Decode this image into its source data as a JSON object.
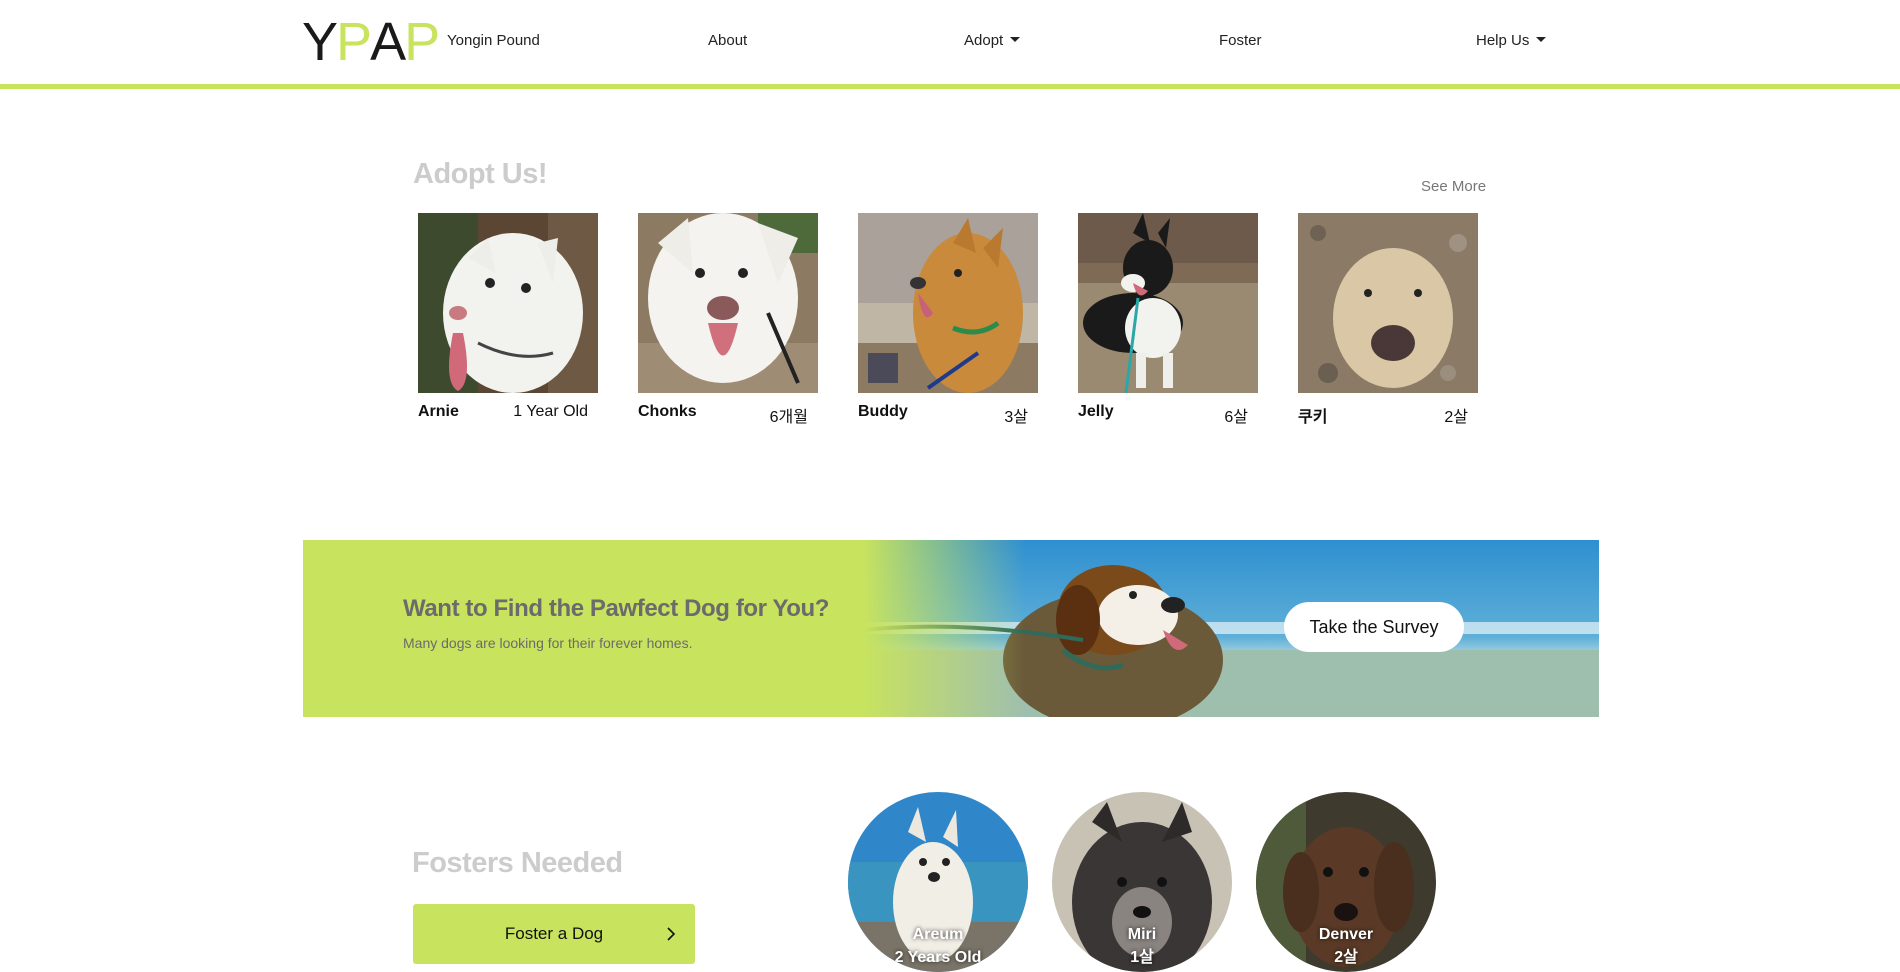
{
  "brand": {
    "logo_letters": [
      "Y",
      "P",
      "A",
      "P"
    ],
    "logo_colors": [
      "#1a1a1a",
      "#c8e35e",
      "#1a1a1a",
      "#c8e35e"
    ],
    "name": "Yongin Pound"
  },
  "nav": {
    "about": "About",
    "adopt": "Adopt",
    "foster": "Foster",
    "help": "Help Us"
  },
  "adopt": {
    "title": "Adopt Us!",
    "see_more": "See More",
    "dogs": [
      {
        "name": "Arnie",
        "age": "1 Year Old"
      },
      {
        "name": "Chonks",
        "age": "6개월"
      },
      {
        "name": "Buddy",
        "age": "3살"
      },
      {
        "name": "Jelly",
        "age": "6살"
      },
      {
        "name": "쿠키",
        "age": "2살"
      }
    ]
  },
  "banner": {
    "title": "Want to Find the Pawfect Dog for You?",
    "subtitle": "Many dogs are looking for their forever homes.",
    "button": "Take the Survey"
  },
  "fosters": {
    "title": "Fosters Needed",
    "button": "Foster a Dog",
    "dogs": [
      {
        "name": "Areum",
        "age": "2 Years Old"
      },
      {
        "name": "Miri",
        "age": "1살"
      },
      {
        "name": "Denver",
        "age": "2살"
      }
    ]
  },
  "colors": {
    "accent": "#c8e35e",
    "title_gray": "#cccccc",
    "banner_text": "#6b6b6b"
  }
}
